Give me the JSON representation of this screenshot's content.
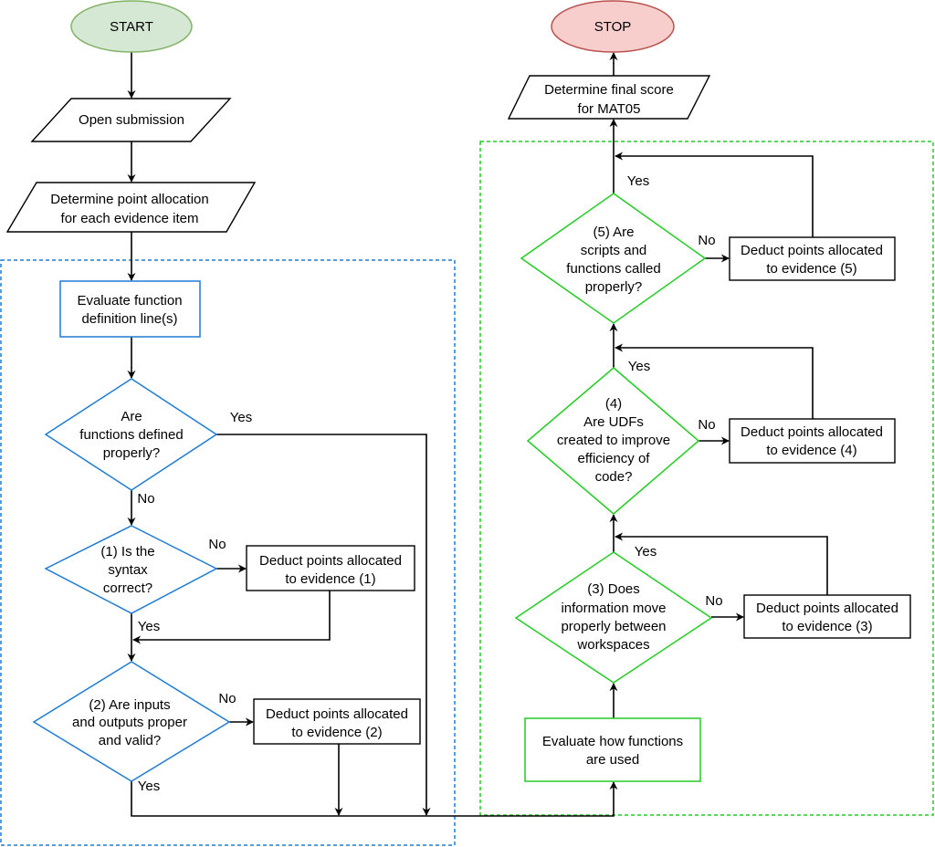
{
  "colors": {
    "blue_group": "#1e7bd4",
    "green_group": "#22cc22",
    "start_fill": "#d5e8d4",
    "start_stroke": "#82b366",
    "stop_fill": "#f8cecc",
    "stop_stroke": "#b85450"
  },
  "nodes": {
    "start": "START",
    "stop": "STOP",
    "open": "Open submission",
    "alloc": [
      "Determine point allocation",
      "for each evidence item"
    ],
    "evaldef": [
      "Evaluate function",
      "definition line(s)"
    ],
    "q_defined": [
      "Are",
      "functions defined",
      "properly?"
    ],
    "q1": [
      "(1) Is the",
      "syntax",
      "correct?"
    ],
    "q2": [
      "(2) Are inputs",
      "and outputs proper",
      "and valid?"
    ],
    "d1": [
      "Deduct points allocated",
      "to evidence (1)"
    ],
    "d2": [
      "Deduct points allocated",
      "to evidence (2)"
    ],
    "evaluse": [
      "Evaluate how functions",
      "are used"
    ],
    "q3": [
      "(3) Does",
      "information move",
      "properly between",
      "workspaces"
    ],
    "q4": [
      "(4)",
      "Are UDFs",
      "created to improve",
      "efficiency of",
      "code?"
    ],
    "q5": [
      "(5) Are",
      "scripts and",
      "functions called",
      "properly?"
    ],
    "d3": [
      "Deduct points allocated",
      "to evidence (3)"
    ],
    "d4": [
      "Deduct points allocated",
      "to evidence (4)"
    ],
    "d5": [
      "Deduct points allocated",
      "to evidence (5)"
    ],
    "final": [
      "Determine final score",
      "for MAT05"
    ]
  },
  "labels": {
    "yes": "Yes",
    "no": "No"
  }
}
